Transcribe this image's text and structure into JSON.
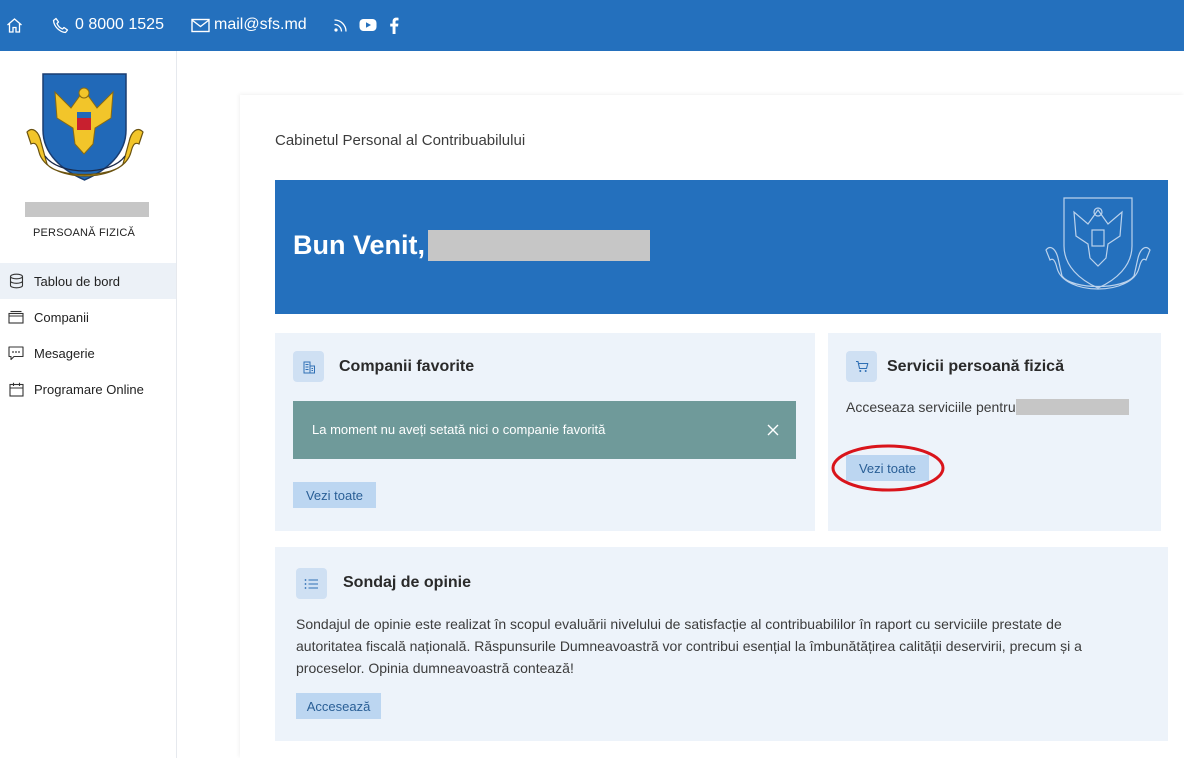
{
  "topbar": {
    "phone": "0 8000 1525",
    "email": "mail@sfs.md",
    "icons": [
      "home-icon",
      "phone-icon",
      "mail-icon",
      "rss-icon",
      "youtube-icon",
      "facebook-icon"
    ]
  },
  "sidebar": {
    "role": "PERSOANĂ FIZICĂ",
    "items": [
      {
        "label": "Tablou de bord",
        "icon": "database-icon",
        "active": true
      },
      {
        "label": "Companii",
        "icon": "briefcase-icon",
        "active": false
      },
      {
        "label": "Mesagerie",
        "icon": "chat-icon",
        "active": false
      },
      {
        "label": "Programare Online",
        "icon": "calendar-icon",
        "active": false
      }
    ]
  },
  "main": {
    "breadcrumb": "Cabinetul Personal al Contribuabilului",
    "welcome": "Bun Venit,",
    "favorites": {
      "title": "Companii favorite",
      "alert": "La moment nu aveți setată nici o companie favorită",
      "button": "Vezi toate"
    },
    "services": {
      "title": "Servicii persoană fizică",
      "description": "Acceseaza serviciile pentru",
      "button": "Vezi toate"
    },
    "survey": {
      "title": "Sondaj de opinie",
      "text_line1": "Sondajul de opinie este realizat în scopul evaluării nivelului de satisfacție al contribuabililor în raport cu serviciile prestate de",
      "text_line2": "autoritatea fiscală națională. Răspunsurile Dumneavoastră vor contribui esențial la îmbunătățirea calității deservirii, precum și a",
      "text_line3": "proceselor. Opinia dumneavoastră contează!",
      "button": "Accesează"
    }
  },
  "colors": {
    "brand_blue": "#2470bd",
    "card_bg": "#edf3fa",
    "alert_bg": "#6f9a9a",
    "button_bg": "#bcd6f1",
    "highlight_red": "#d9141b"
  }
}
